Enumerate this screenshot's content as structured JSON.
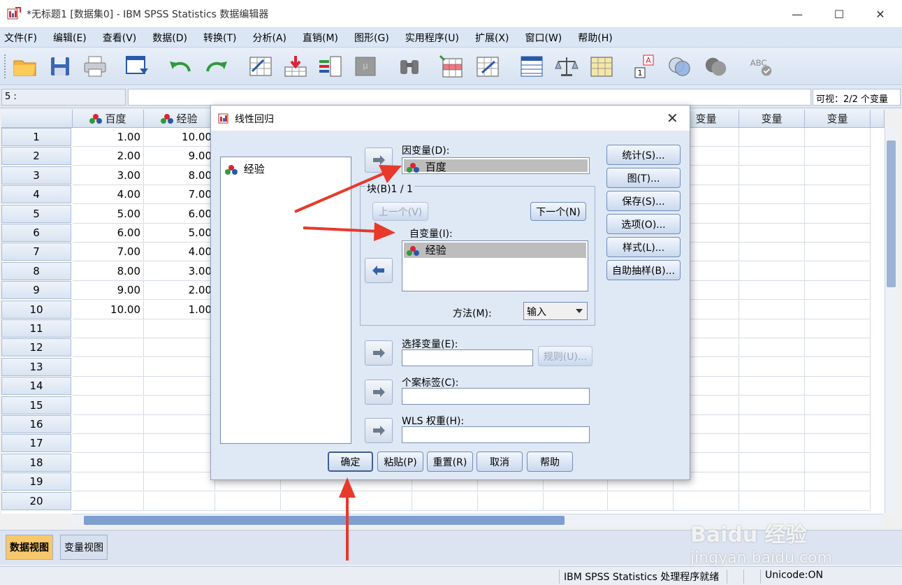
{
  "window": {
    "title": "*无标题1 [数据集0] - IBM SPSS Statistics 数据编辑器",
    "minimize": "—",
    "maximize": "☐",
    "close": "✕"
  },
  "menu": [
    "文件(F)",
    "编辑(E)",
    "查看(V)",
    "数据(D)",
    "转换(T)",
    "分析(A)",
    "直销(M)",
    "图形(G)",
    "实用程序(U)",
    "扩展(X)",
    "窗口(W)",
    "帮助(H)"
  ],
  "cellbar": {
    "cell_ref": "5 :",
    "visible": "可视：2/2 个变量"
  },
  "grid": {
    "columns": [
      "百度",
      "经验",
      "变量",
      "变量",
      "变量"
    ],
    "row_numbers": [
      "1",
      "2",
      "3",
      "4",
      "5",
      "6",
      "7",
      "8",
      "9",
      "10",
      "11",
      "12",
      "13",
      "14",
      "15",
      "16",
      "17",
      "18",
      "19",
      "20"
    ],
    "col_baidu": [
      "1.00",
      "2.00",
      "3.00",
      "4.00",
      "5.00",
      "6.00",
      "7.00",
      "8.00",
      "9.00",
      "10.00"
    ],
    "col_jingyan": [
      "10.00",
      "9.00",
      "8.00",
      "7.00",
      "6.00",
      "5.00",
      "4.00",
      "3.00",
      "2.00",
      "1.00"
    ]
  },
  "tabs": {
    "data_view": "数据视图",
    "variable_view": "变量视图"
  },
  "status": {
    "processor": "IBM SPSS Statistics 处理程序就绪",
    "unicode": "Unicode:ON"
  },
  "dialog": {
    "title": "线性回归",
    "source_vars": [
      "经验"
    ],
    "dependent_label": "因变量(D):",
    "dependent_value": "百度",
    "block_label": "块(B)1 / 1",
    "prev_button": "上一个(V)",
    "next_button": "下一个(N)",
    "independent_label": "自变量(I):",
    "independent_values": [
      "经验"
    ],
    "method_label": "方法(M):",
    "method_value": "输入",
    "selection_label": "选择变量(E):",
    "rule_button": "规则(U)...",
    "case_label": "个案标签(C):",
    "wls_label": "WLS 权重(H):",
    "side_buttons": [
      "统计(S)...",
      "图(T)...",
      "保存(S)...",
      "选项(O)...",
      "样式(L)...",
      "自助抽样(B)..."
    ],
    "bottom_buttons": [
      "确定",
      "粘贴(P)",
      "重置(R)",
      "取消",
      "帮助"
    ],
    "close": "✕"
  },
  "watermark": {
    "main": "Baidu 经验",
    "sub": "jingyan.baidu.com"
  },
  "colors": {
    "arrow_red": "#e8392b",
    "dialog_bg": "#dfe8f5",
    "menu_bg": "#dbe6f4"
  }
}
